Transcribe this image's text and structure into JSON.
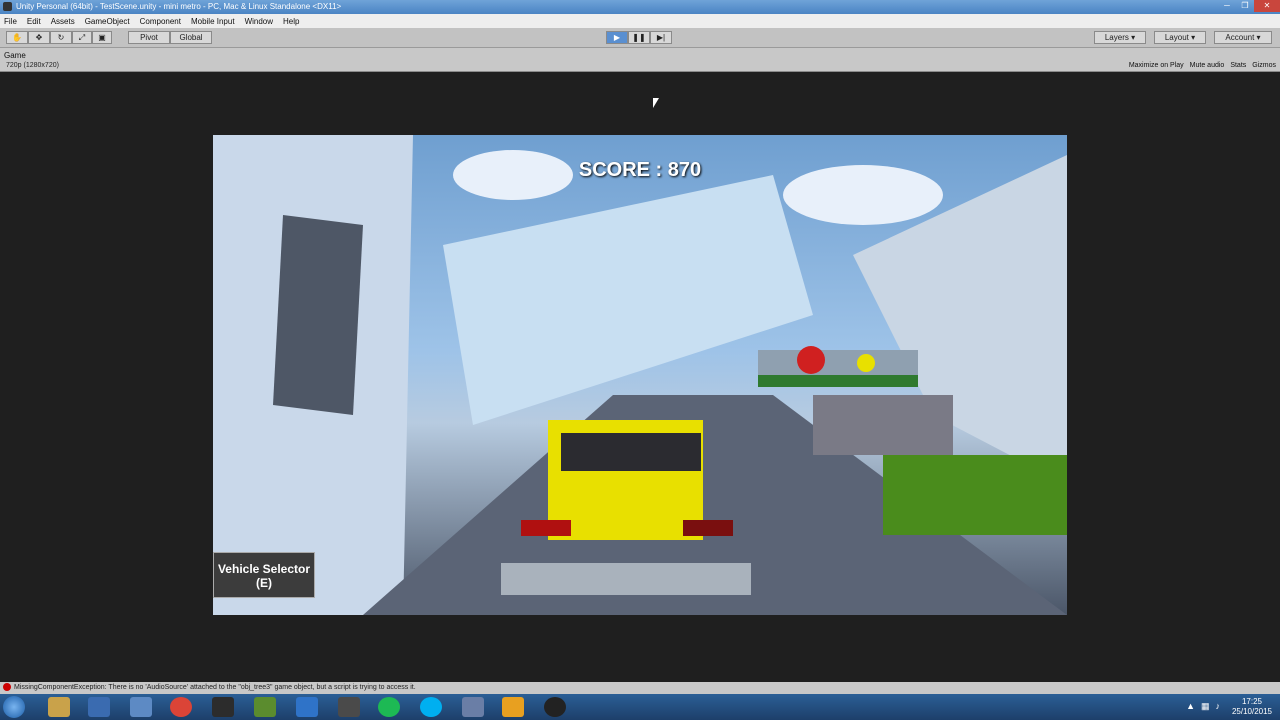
{
  "window": {
    "title": "Unity Personal (64bit) - TestScene.unity - mini metro - PC, Mac & Linux Standalone <DX11>",
    "controls": [
      "─",
      "❐",
      "✕"
    ]
  },
  "menu": [
    "File",
    "Edit",
    "Assets",
    "GameObject",
    "Component",
    "Mobile Input",
    "Window",
    "Help"
  ],
  "toolbar": {
    "pivot_label": "Pivot",
    "global_label": "Global",
    "layers_label": "Layers",
    "layout_label": "Layout",
    "account_label": "Account"
  },
  "game_view": {
    "tab_label": "Game",
    "resolution": "720p (1280x720)",
    "options": [
      "Maximize on Play",
      "Mute audio",
      "Stats",
      "Gizmos"
    ]
  },
  "hud": {
    "score_text": "SCORE : 870",
    "vehicle_selector": "Vehicle Selector",
    "vehicle_selector_key": "(E)"
  },
  "console": {
    "message": "MissingComponentException: There is no 'AudioSource' attached to the \"obj_tree3\" game object, but a script is trying to access it."
  },
  "taskbar": {
    "time": "17:25",
    "date": "25/10/2015"
  },
  "colors": {
    "play_active": "#5a8fd0",
    "taskbar": "#1d3f6a",
    "taxi_yellow": "#e8e000",
    "error_red": "#cc0000"
  }
}
